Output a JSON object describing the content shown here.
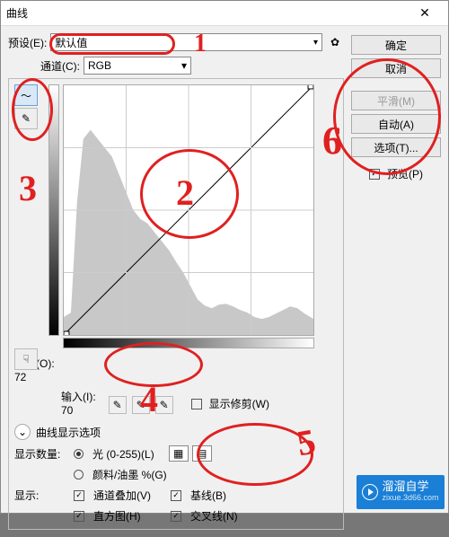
{
  "window": {
    "title": "曲线"
  },
  "preset": {
    "label": "预设(E):",
    "value": "默认值"
  },
  "channel": {
    "label": "通道(C):",
    "value": "RGB"
  },
  "tools": {
    "curve": "curve-tool",
    "pencil": "pencil-tool",
    "hand": "hand-tool"
  },
  "output": {
    "label": "输出(O):",
    "value": "72"
  },
  "input": {
    "label": "输入(I):",
    "value": "70"
  },
  "clip": {
    "label": "显示修剪(W)"
  },
  "displayHeader": "曲线显示选项",
  "displayQty": {
    "label": "显示数量:",
    "opt1": "光 (0-255)(L)",
    "opt2": "颜料/油墨 %(G)"
  },
  "show": {
    "label": "显示:",
    "c1": "通道叠加(V)",
    "c2": "基线(B)",
    "c3": "直方图(H)",
    "c4": "交叉线(N)"
  },
  "buttons": {
    "ok": "确定",
    "cancel": "取消",
    "smooth": "平滑(M)",
    "auto": "自动(A)",
    "options": "选项(T)..."
  },
  "preview": {
    "label": "预览(P)"
  },
  "chart_data": {
    "type": "curve-histogram",
    "title": "",
    "xlabel": "输入",
    "ylabel": "输出",
    "xlim": [
      0,
      255
    ],
    "ylim": [
      0,
      255
    ],
    "curve_points": [
      [
        0,
        0
      ],
      [
        255,
        255
      ]
    ],
    "histogram": [
      20,
      22,
      60,
      210,
      220,
      200,
      180,
      170,
      150,
      120,
      100,
      90,
      95,
      92,
      80,
      70,
      65,
      60,
      55,
      45,
      35,
      28,
      25,
      28,
      30,
      28,
      25,
      20,
      18,
      20,
      22,
      18,
      15,
      12,
      10,
      8,
      6,
      5,
      4,
      4,
      5,
      6,
      5,
      4,
      3,
      3,
      4,
      5,
      4,
      3,
      2,
      2,
      3,
      4,
      6,
      8,
      9,
      10,
      8,
      6,
      5,
      4,
      3,
      2
    ]
  },
  "annotations": [
    "1",
    "2",
    "3",
    "4",
    "5",
    "6"
  ],
  "watermark": {
    "brand": "溜溜自学",
    "url": "zixue.3d66.com"
  }
}
